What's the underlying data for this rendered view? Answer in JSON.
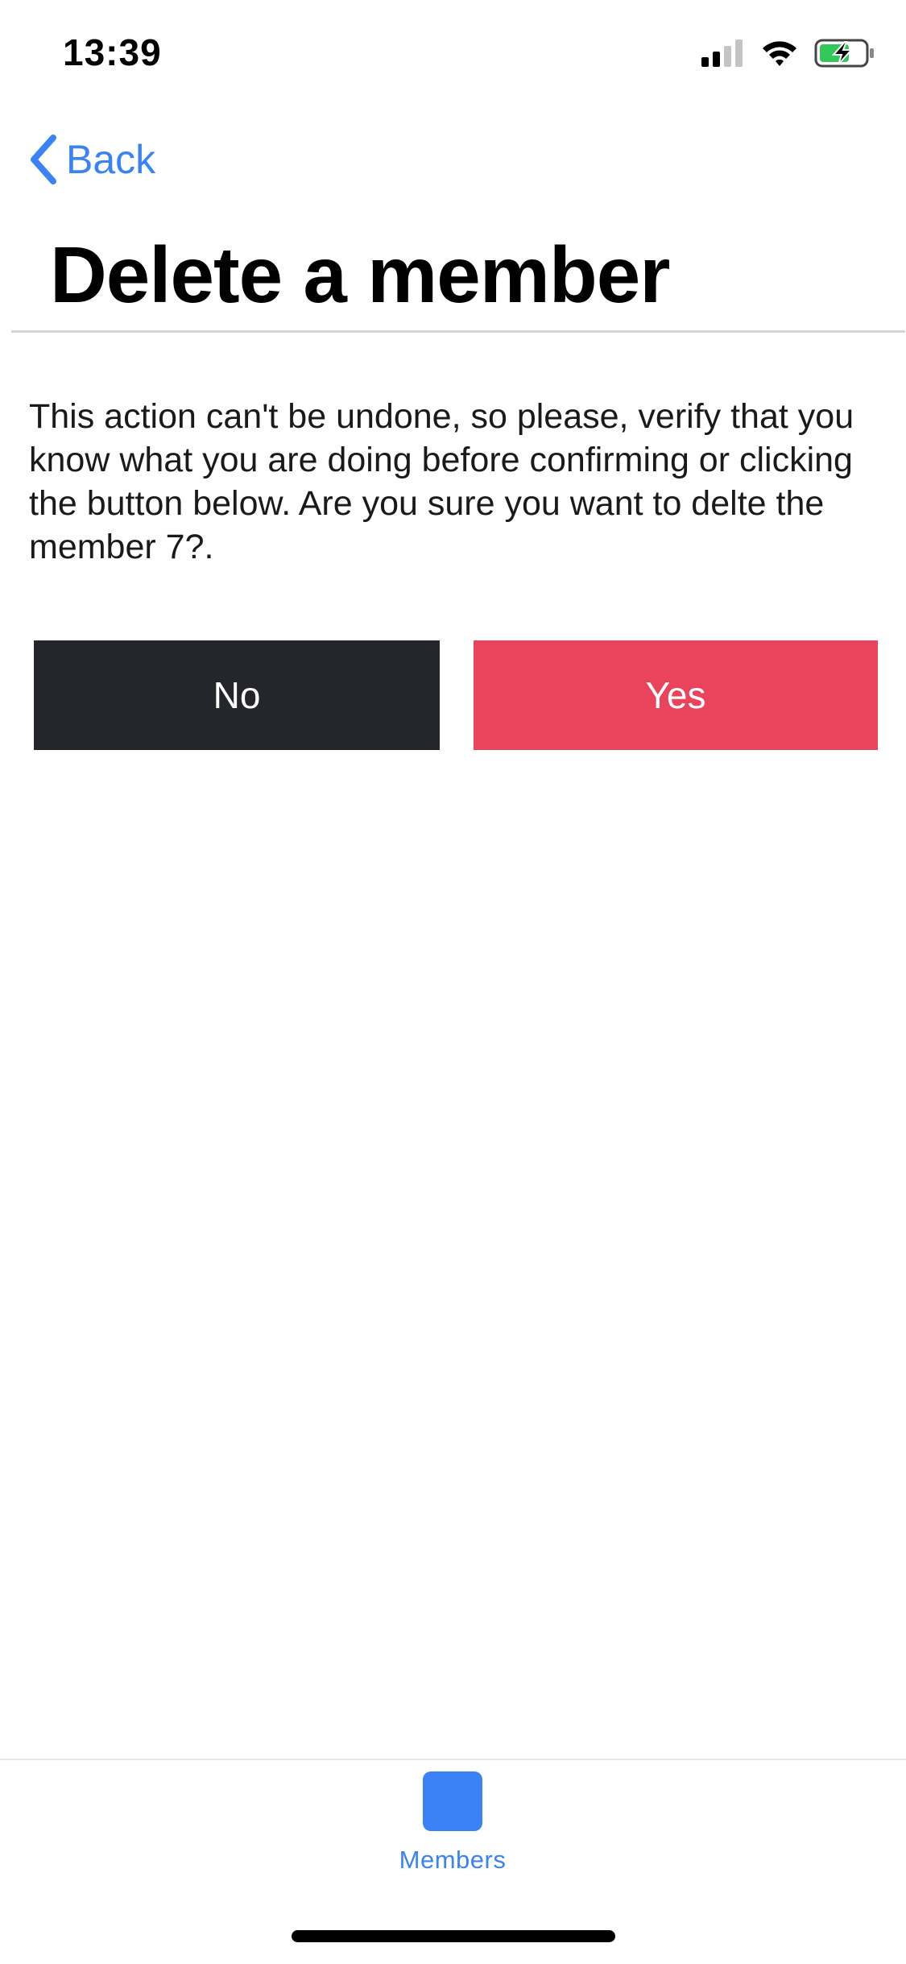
{
  "status_bar": {
    "time": "13:39",
    "signal_icon": "cellular-signal-icon",
    "wifi_icon": "wifi-icon",
    "battery_icon": "battery-charging-icon",
    "battery_color": "#34c759"
  },
  "nav": {
    "back_label": "Back",
    "back_icon": "chevron-left-icon"
  },
  "page": {
    "title": "Delete a member",
    "message": "This action can't be undone, so please, verify that you know what you are doing before confirming or clicking the button below. Are you sure you want to delte the member 7?."
  },
  "actions": {
    "no_label": "No",
    "yes_label": "Yes",
    "no_color": "#25262b",
    "yes_color": "#e9445c"
  },
  "tab_bar": {
    "items": [
      {
        "label": "Members",
        "icon": "members-tab-icon",
        "active": true
      }
    ],
    "accent": "#3b82f6"
  }
}
